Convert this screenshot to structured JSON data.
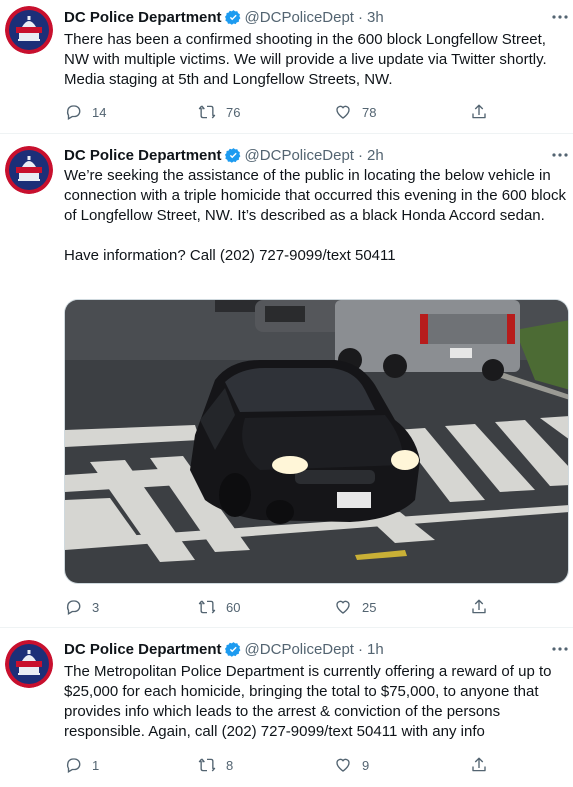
{
  "account": {
    "name": "DC Police Department",
    "handle": "@DCPoliceDept",
    "dot": "·"
  },
  "tweets": [
    {
      "time": "3h",
      "text": "There has been a confirmed shooting in the 600 block Longfellow Street, NW with multiple victims. We will provide a live update via Twitter shortly. Media staging at 5th and Longfellow Streets, NW.",
      "replies": "14",
      "retweets": "76",
      "likes": "78"
    },
    {
      "time": "2h",
      "text": "We’re seeking the assistance of the public in locating the below vehicle in connection with a triple homicide that occurred this evening in the 600 block of Longfellow Street, NW. It’s described as a black Honda Accord sedan.\n\nHave information? Call (202) 727-9099/text 50411",
      "replies": "3",
      "retweets": "60",
      "likes": "25"
    },
    {
      "time": "1h",
      "text": "The Metropolitan Police Department is currently offering a reward of up to $25,000 for each homicide, bringing the total to $75,000, to anyone that provides info which leads to the arrest & conviction of the persons responsible. Again, call (202) 727-9099/text 50411 with any info",
      "replies": "1",
      "retweets": "8",
      "likes": "9"
    }
  ],
  "icons": {
    "verified": "verified-badge-icon",
    "more": "more-icon",
    "reply": "reply-icon",
    "retweet": "retweet-icon",
    "like": "like-icon",
    "share": "share-icon"
  },
  "colors": {
    "text": "#0f1419",
    "secondary": "#536471",
    "verified": "#1d9bf0",
    "avatar_bg": "#1c2f78",
    "avatar_ring": "#c8102e"
  }
}
